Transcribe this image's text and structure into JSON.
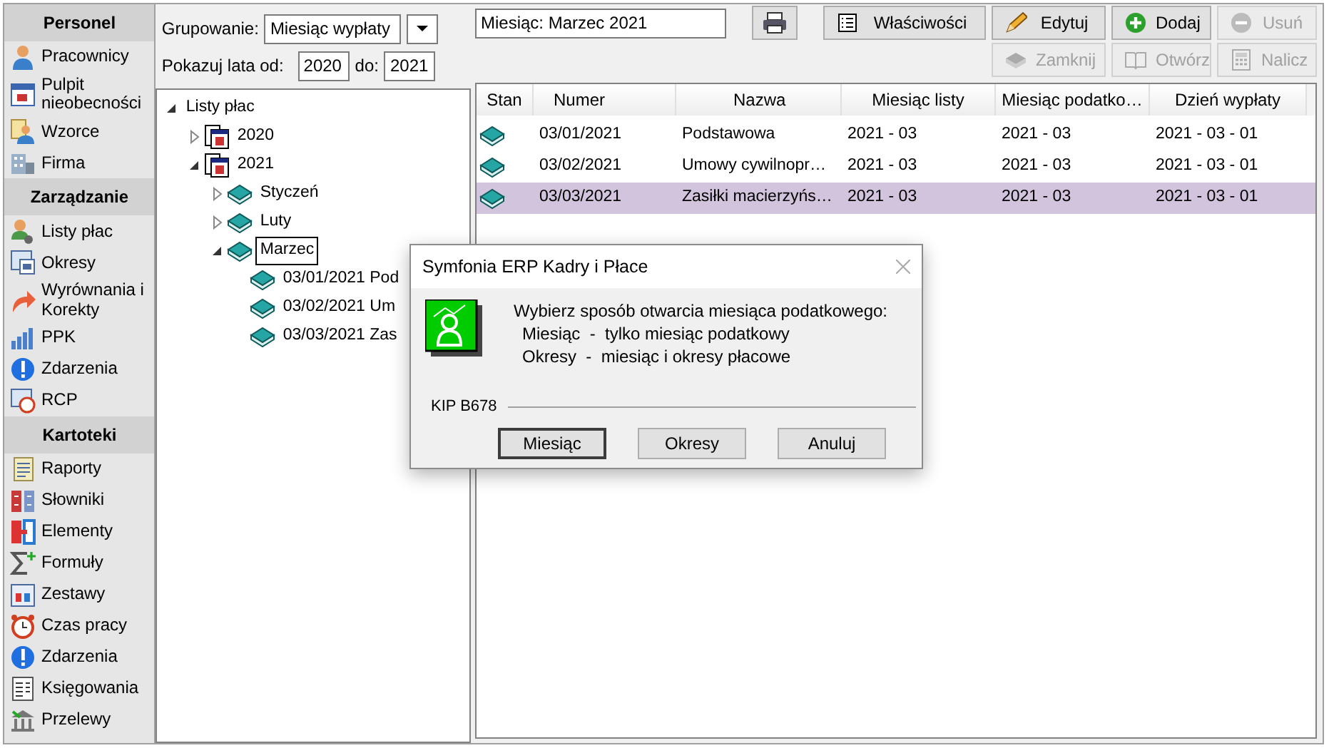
{
  "sidebar": {
    "sections": [
      {
        "title": "Personel",
        "items": [
          {
            "label": "Pracownicy"
          },
          {
            "label": "Pulpit nieobecności"
          },
          {
            "label": "Wzorce"
          },
          {
            "label": "Firma"
          }
        ]
      },
      {
        "title": "Zarządzanie",
        "items": [
          {
            "label": "Listy płac"
          },
          {
            "label": "Okresy"
          },
          {
            "label": "Wyrównania i Korekty"
          },
          {
            "label": "PPK"
          },
          {
            "label": "Zdarzenia"
          },
          {
            "label": "RCP"
          }
        ]
      },
      {
        "title": "Kartoteki",
        "items": [
          {
            "label": "Raporty"
          },
          {
            "label": "Słowniki"
          },
          {
            "label": "Elementy"
          },
          {
            "label": "Formuły"
          },
          {
            "label": "Zestawy"
          },
          {
            "label": "Czas pracy"
          },
          {
            "label": "Zdarzenia"
          },
          {
            "label": "Księgowania"
          },
          {
            "label": "Przelewy"
          }
        ]
      }
    ]
  },
  "filters": {
    "grouping_label": "Grupowanie:",
    "grouping_value": "Miesiąc wypłaty",
    "years_label": "Pokazuj lata od:",
    "year_from": "2020",
    "to_label": "do:",
    "year_to": "2021"
  },
  "tree": {
    "label": "Listy płac",
    "expanded": true,
    "selected": false,
    "children": [
      {
        "label": "2020",
        "kind": "year",
        "expanded": false,
        "selected": false
      },
      {
        "label": "2021",
        "kind": "year",
        "expanded": true,
        "selected": false,
        "children": [
          {
            "label": "Styczeń",
            "kind": "month",
            "expanded": false,
            "selected": false
          },
          {
            "label": "Luty",
            "kind": "month",
            "expanded": false,
            "selected": false
          },
          {
            "label": "Marzec",
            "kind": "month",
            "expanded": true,
            "selected": true,
            "children": [
              {
                "label": "03/01/2021 Pod",
                "kind": "list",
                "selected": false
              },
              {
                "label": "03/02/2021 Um",
                "kind": "list",
                "selected": false
              },
              {
                "label": "03/03/2021 Zas",
                "kind": "list",
                "selected": false
              }
            ]
          }
        ]
      }
    ]
  },
  "current_field": {
    "value": "Miesiąc: Marzec 2021"
  },
  "toolbar": [
    {
      "label": "Właściwości",
      "kind": "properties",
      "disabled": false
    },
    {
      "label": "Edytuj",
      "kind": "edit",
      "disabled": false
    },
    {
      "label": "Dodaj",
      "kind": "add",
      "disabled": false
    },
    {
      "label": "Usuń",
      "kind": "remove",
      "disabled": true
    },
    {
      "label": "Zamknij",
      "kind": "close",
      "disabled": true
    },
    {
      "label": "Otwórz",
      "kind": "open",
      "disabled": true
    },
    {
      "label": "Nalicz",
      "kind": "calc",
      "disabled": true
    }
  ],
  "table": {
    "columns": [
      "Stan",
      "Numer",
      "Nazwa",
      "Miesiąc listy",
      "Miesiąc podatko…",
      "Dzień wypłaty"
    ],
    "rows": [
      {
        "cells": [
          "",
          "03/01/2021",
          "Podstawowa",
          "2021 - 03",
          "2021 - 03",
          "2021 - 03 - 01"
        ],
        "selected": false
      },
      {
        "cells": [
          "",
          "03/02/2021",
          "Umowy cywilnopr…",
          "2021 - 03",
          "2021 - 03",
          "2021 - 03 - 01"
        ],
        "selected": false
      },
      {
        "cells": [
          "",
          "03/03/2021",
          "Zasiłki macierzyńs…",
          "2021 - 03",
          "2021 - 03",
          "2021 - 03 - 01"
        ],
        "selected": true
      }
    ]
  },
  "dialog": {
    "title": "Symfonia ERP Kadry i Płace",
    "message": [
      "Wybierz sposób otwarcia miesiąca podatkowego:",
      "Miesiąc  -  tylko miesiąc podatkowy",
      "Okresy  -  miesiąc i okresy płacowe"
    ],
    "code": "KIP B678",
    "buttons": [
      {
        "label": "Miesiąc",
        "default": true
      },
      {
        "label": "Okresy",
        "default": false
      },
      {
        "label": "Anuluj",
        "default": false
      }
    ]
  }
}
